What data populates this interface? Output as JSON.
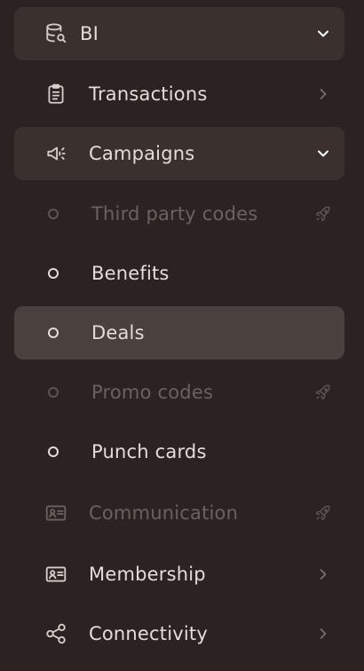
{
  "nav": {
    "bi": {
      "label": "BI",
      "icon": "database-search-icon",
      "chevron": "chevron-down-icon"
    },
    "transactions": {
      "label": "Transactions",
      "icon": "clipboard-list-icon",
      "chevron": "chevron-right-icon"
    },
    "campaigns": {
      "label": "Campaigns",
      "icon": "megaphone-icon",
      "chevron": "chevron-down-icon"
    },
    "campaign_items": [
      {
        "label": "Third party codes",
        "disabled": true,
        "trail_icon": "rocket-icon"
      },
      {
        "label": "Benefits",
        "disabled": false
      },
      {
        "label": "Deals",
        "disabled": false,
        "selected": true
      },
      {
        "label": "Promo codes",
        "disabled": true,
        "trail_icon": "rocket-icon"
      },
      {
        "label": "Punch cards",
        "disabled": false
      }
    ],
    "communication": {
      "label": "Communication",
      "icon": "id-card-icon",
      "disabled": true,
      "trail_icon": "rocket-icon"
    },
    "membership": {
      "label": "Membership",
      "icon": "id-card-icon",
      "chevron": "chevron-right-icon"
    },
    "connectivity": {
      "label": "Connectivity",
      "icon": "share-nodes-icon",
      "chevron": "chevron-right-icon"
    }
  },
  "colors": {
    "background": "#2b2322",
    "group_highlight": "#3a312f",
    "selected_highlight": "#4a403e",
    "text": "#e4dcd8",
    "text_disabled": "#6b615e"
  }
}
